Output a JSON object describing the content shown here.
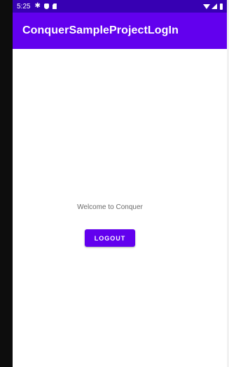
{
  "status_bar": {
    "time": "5:25",
    "left_icons": [
      "gear-icon",
      "shield-icon",
      "sdcard-icon"
    ],
    "right_icons": [
      "wifi-icon",
      "signal-icon",
      "battery-icon"
    ]
  },
  "app_bar": {
    "title": "ConquerSampleProjectLogIn"
  },
  "main": {
    "welcome_text": "Welcome to Conquer",
    "logout_label": "LOGOUT"
  },
  "colors": {
    "status_bar": "#3700b3",
    "primary": "#6200ee",
    "text_secondary": "#6b6b6b"
  }
}
